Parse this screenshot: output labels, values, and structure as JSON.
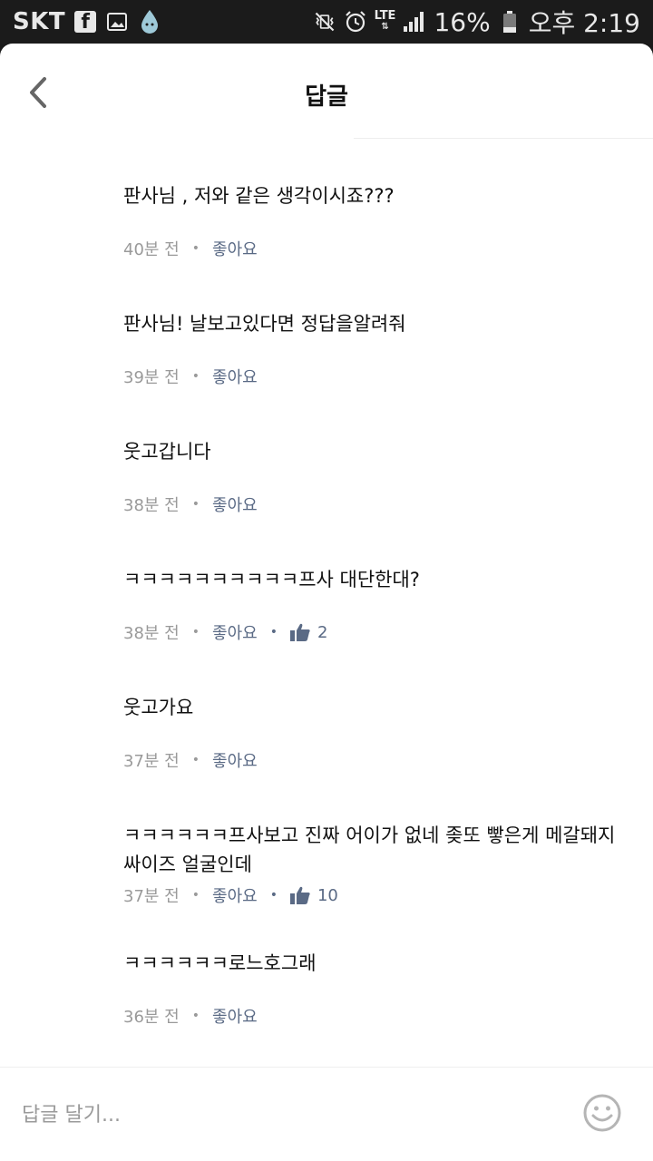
{
  "status_bar": {
    "carrier": "SKT",
    "network": "LTE",
    "battery": "16%",
    "time": "오후 2:19"
  },
  "header": {
    "title": "답글"
  },
  "comments": [
    {
      "text": "판사님 , 저와 같은 생각이시죠???",
      "time": "40분 전",
      "like_label": "좋아요",
      "likes": null
    },
    {
      "text": "판사님! 날보고있다면 정답을알려줘",
      "time": "39분 전",
      "like_label": "좋아요",
      "likes": null
    },
    {
      "text": "웃고갑니다",
      "time": "38분 전",
      "like_label": "좋아요",
      "likes": null
    },
    {
      "text": "ㅋㅋㅋㅋㅋㅋㅋㅋㅋㅋ프사 대단한대?",
      "time": "38분 전",
      "like_label": "좋아요",
      "likes": "2"
    },
    {
      "text": "웃고가요",
      "time": "37분 전",
      "like_label": "좋아요",
      "likes": null
    },
    {
      "text": "ㅋㅋㅋㅋㅋㅋ프사보고 진짜 어이가 없네 좆또 빻은게 메갈돼지 싸이즈 얼굴인데",
      "time": "37분 전",
      "like_label": "좋아요",
      "likes": "10"
    },
    {
      "text": "ㅋㅋㅋㅋㅋㅋ로느호그래",
      "time": "36분 전",
      "like_label": "좋아요",
      "likes": null
    }
  ],
  "reply": {
    "placeholder": "답글 달기..."
  },
  "icons": {
    "back": "chevron-left-icon",
    "thumb": "thumbs-up-icon",
    "emoji": "smiley-icon"
  },
  "colors": {
    "like_accent": "#5a6a85",
    "meta_gray": "#9a9a9a",
    "status_bar": "#1b1b1b"
  }
}
